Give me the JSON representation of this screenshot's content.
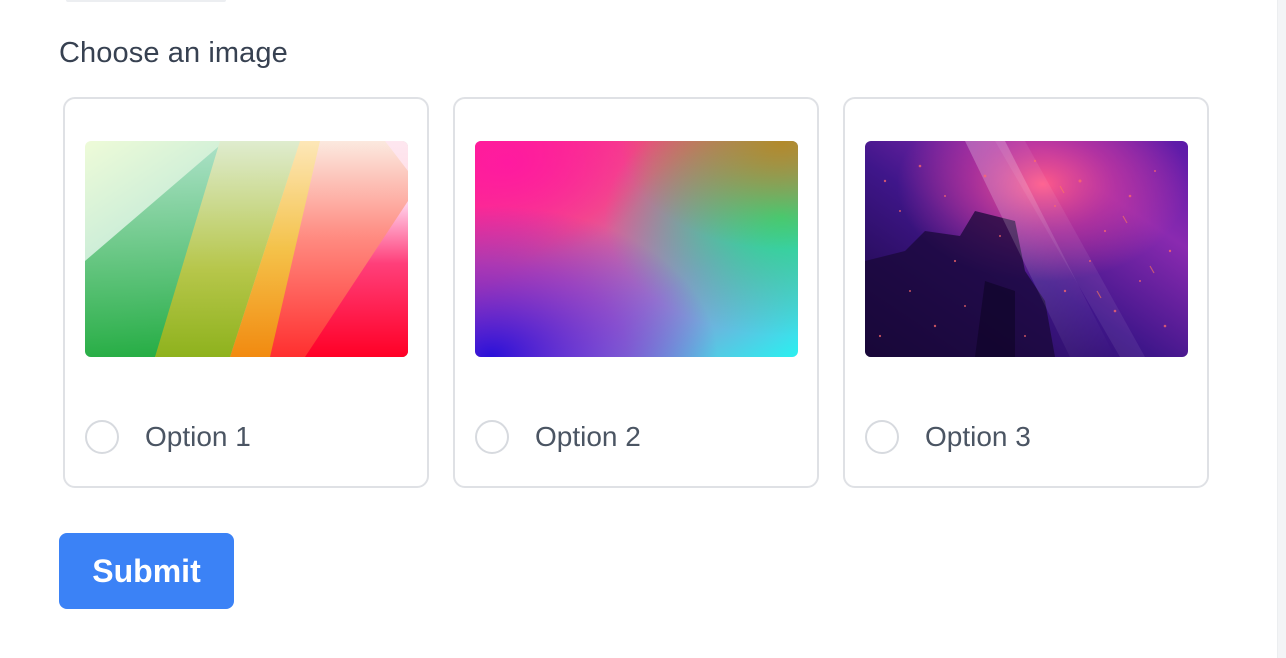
{
  "form": {
    "question": "Choose an image",
    "submit_label": "Submit",
    "options": [
      {
        "label": "Option 1",
        "selected": false,
        "image": "colorful-diagonal-stripes"
      },
      {
        "label": "Option 2",
        "selected": false,
        "image": "pink-purple-teal-gradient"
      },
      {
        "label": "Option 3",
        "selected": false,
        "image": "purple-night-window-with-rain"
      }
    ]
  },
  "colors": {
    "accent": "#3b82f6",
    "card_border": "#dfe1e5",
    "text_dark": "#374151",
    "text_muted": "#4b5563"
  }
}
